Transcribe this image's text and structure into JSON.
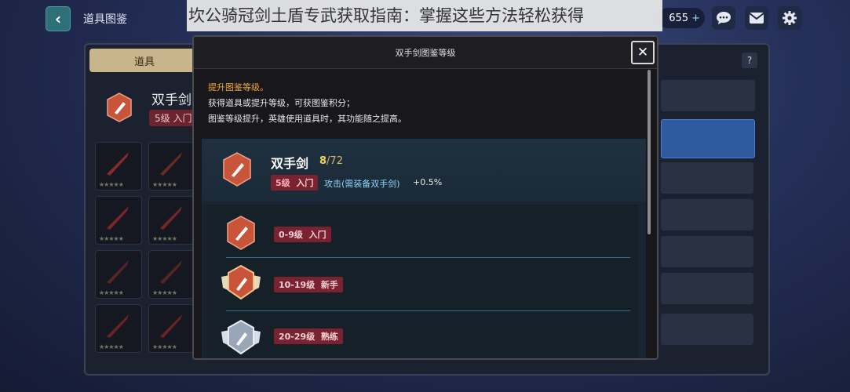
{
  "topbar": {
    "back_label": "‹",
    "screen_title": "道具图鉴",
    "currency_value": "655",
    "currency_plus": "+",
    "icons": [
      "chat-icon",
      "mail-icon",
      "gear-icon"
    ]
  },
  "banner": {
    "text": "坎公骑冠剑土盾专武获取指南：掌握这些方法轻松获得"
  },
  "background": {
    "tab_label": "道具",
    "item_name": "双手剑",
    "item_badge": "5级 入门",
    "help_label": "?"
  },
  "modal": {
    "title": "双手剑图鉴等级",
    "close_label": "✕",
    "info_heading": "提升图鉴等级。",
    "info_lines": [
      "获得道具或提升等级，可获图鉴积分；",
      "图鉴等级提升，英雄使用道具时，其功能随之提高。"
    ],
    "weapon": {
      "name": "双手剑",
      "count_current": "8",
      "count_max": "/72",
      "level_num": "5级",
      "level_name": "入门",
      "effect": "攻击(需装备双手剑)",
      "bonus": "+0.5%"
    },
    "tiers": [
      {
        "range": "0-9",
        "unit": "级",
        "name": "入门",
        "color": "#c8553a"
      },
      {
        "range": "10-19",
        "unit": "级",
        "name": "新手",
        "color": "#c8553a"
      },
      {
        "range": "20-29",
        "unit": "级",
        "name": "熟练",
        "color": "#9aa6b8"
      }
    ]
  },
  "colors": {
    "accent_gold": "#f3d060",
    "badge_red": "#7a2230",
    "effect_blue": "#8fd6ff",
    "shield_red": "#c8553a"
  }
}
